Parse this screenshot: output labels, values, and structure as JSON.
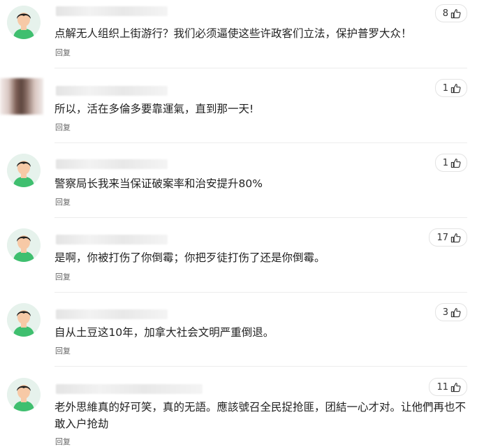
{
  "comments": [
    {
      "avatar": "default-avatar",
      "likes": "8",
      "text": "点解无人组织上街游行？我们必须逼使这些许政客们立法，保护普罗大众！",
      "reply_label": "回复"
    },
    {
      "avatar": "photo-avatar",
      "likes": "1",
      "text": "所以，活在多倫多要靠運氣，直到那一天!",
      "reply_label": "回复"
    },
    {
      "avatar": "default-avatar",
      "likes": "1",
      "text": "警察局长我来当保证破案率和治安提升80%",
      "reply_label": "回复"
    },
    {
      "avatar": "default-avatar",
      "likes": "17",
      "text": "是啊，你被打伤了你倒霉；你把歹徒打伤了还是你倒霉。",
      "reply_label": "回复"
    },
    {
      "avatar": "default-avatar",
      "likes": "3",
      "text": "自从土豆这10年，加拿大社会文明严重倒退。",
      "reply_label": "回复"
    },
    {
      "avatar": "default-avatar",
      "likes": "11",
      "text": "老外思維真的好可笑，真的无語。應該號召全民捉抢匪，团結一心才对。让他們再也不敢入户抢劫",
      "reply_label": "回复"
    }
  ],
  "icons": {
    "like": "thumbs-up-icon",
    "avatar": "person-avatar-icon"
  },
  "colors": {
    "avatar_bg": "#e6f2ec",
    "avatar_shirt": "#3fbf6f",
    "avatar_hair": "#1f1f1f",
    "text": "#222222",
    "meta": "#666666"
  }
}
